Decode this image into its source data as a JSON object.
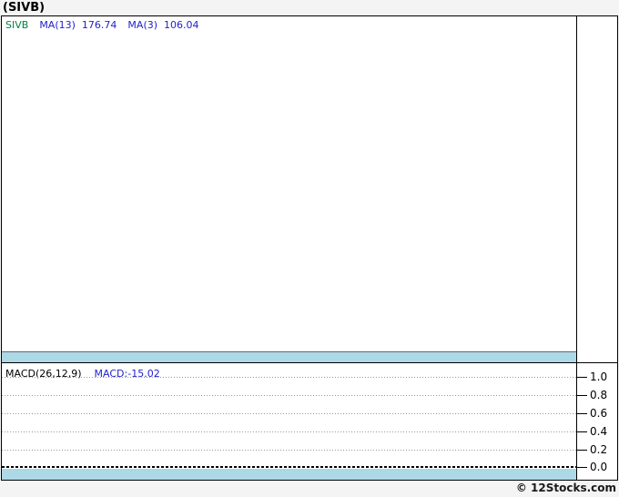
{
  "page": {
    "title": "(SIVB)",
    "copyright": "© 12Stocks.com",
    "background_color": "#f4f4f4"
  },
  "main_chart": {
    "legend": {
      "symbol": "SIVB",
      "ma13_label": "MA(13)",
      "ma13_value": "176.74",
      "ma3_label": "MA(3)",
      "ma3_value": "106.04"
    },
    "colors": {
      "symbol_text": "#008040",
      "ma_text": "#2222cc",
      "band": "#add8e6"
    }
  },
  "macd_panel": {
    "label": "MACD(26,12,9)",
    "value_label": "MACD:-15.02",
    "axis_ticks": [
      "1.0",
      "0.8",
      "0.6",
      "0.4",
      "0.2",
      "0.0"
    ],
    "colors": {
      "value_text": "#2222cc",
      "band": "#add8e6"
    }
  },
  "chart_data": [
    {
      "type": "line",
      "title": "(SIVB) price chart",
      "series": [
        {
          "name": "SIVB",
          "values": []
        },
        {
          "name": "MA(13)",
          "values": [],
          "last_value": 176.74
        },
        {
          "name": "MA(3)",
          "values": [],
          "last_value": 106.04
        }
      ],
      "note": "plot area is empty (no visible price data); light blue band at panel bottom",
      "grid": false,
      "legend_position": "top-left"
    },
    {
      "type": "line",
      "title": "MACD(26,12,9)",
      "series": [
        {
          "name": "MACD",
          "values": [],
          "last_value": -15.02
        }
      ],
      "ylabel": "",
      "ylim": [
        0.0,
        1.0
      ],
      "yticks": [
        1.0,
        0.8,
        0.6,
        0.4,
        0.2,
        0.0
      ],
      "grid": true,
      "note": "dotted horizontal gridlines, dark dashed zero line at 0.0, light blue band at panel bottom, y-axis on right"
    }
  ]
}
